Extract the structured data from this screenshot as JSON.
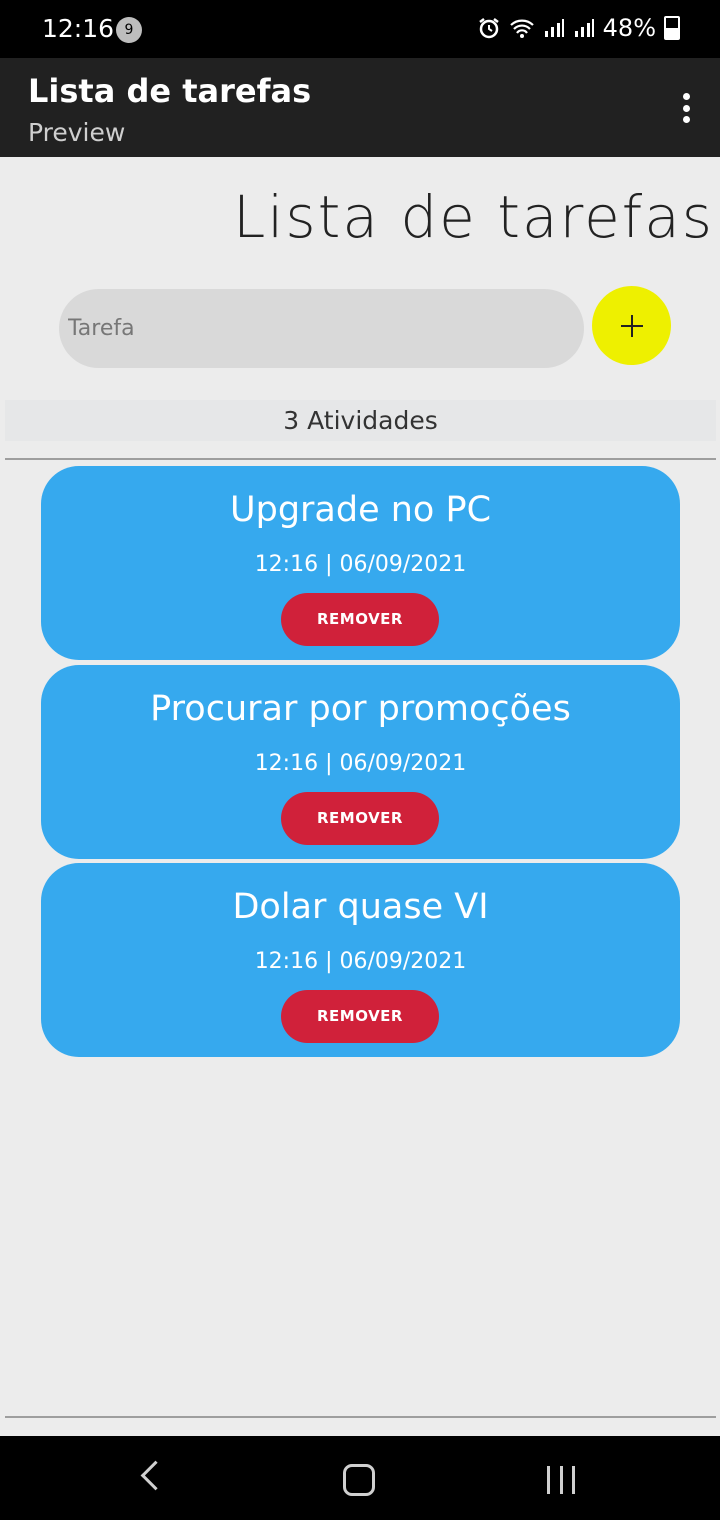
{
  "status_bar": {
    "time": "12:16",
    "notification_count": "9",
    "battery": "48%"
  },
  "app_bar": {
    "title": "Lista de tarefas",
    "subtitle": "Preview"
  },
  "page": {
    "heading": "Lista de tarefas"
  },
  "input": {
    "placeholder": "Tarefa"
  },
  "add_button": {
    "symbol": "+"
  },
  "count_label": "3 Atividades",
  "tasks": [
    {
      "title": "Upgrade no PC",
      "timestamp": "12:16 | 06/09/2021",
      "action": "REMOVER"
    },
    {
      "title": "Procurar por promoções",
      "timestamp": "12:16 | 06/09/2021",
      "action": "REMOVER"
    },
    {
      "title": "Dolar quase VI",
      "timestamp": "12:16 | 06/09/2021",
      "action": "REMOVER"
    }
  ],
  "colors": {
    "card": "#36a9ee",
    "remove_button": "#d0213a",
    "add_button": "#eef000",
    "app_bar": "#212121"
  }
}
